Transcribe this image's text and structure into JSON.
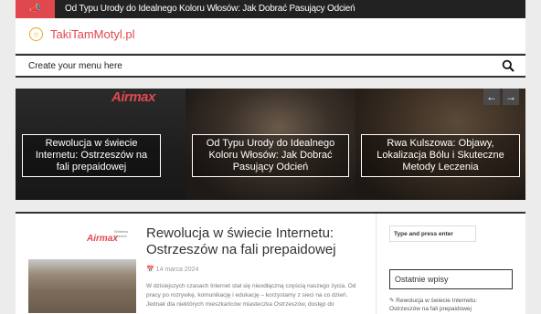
{
  "ticker": {
    "flag_icon": "megaphone-icon",
    "headline": "Od Typu Urody do Idealnego Koloru Włosów: Jak Dobrać Pasujący Odcień"
  },
  "header": {
    "logo_icon": "sun-icon",
    "site_title": "TakiTamMotyl.pl"
  },
  "menu": {
    "label": "Create your menu here",
    "search_icon": "search-icon"
  },
  "slider": {
    "slides": [
      {
        "caption": "Rewolucja w świecie Internetu: Ostrzeszów na fali prepaidowej",
        "brand": "Airmax"
      },
      {
        "caption": "Od Typu Urody do Idealnego Koloru Włosów: Jak Dobrać Pasujący Odcień"
      },
      {
        "caption": "Rwa Kulszowa: Objawy, Lokalizacja Bólu i Skuteczne Metody Leczenia"
      }
    ],
    "prev_label": "←",
    "next_label": "→"
  },
  "post": {
    "thumb_brand": "Airmax",
    "thumb_brand_tagline": "Wireless Internet",
    "title": "Rewolucja w świecie Internetu: Ostrzeszów na fali prepaidowej",
    "date": "14 marca 2024",
    "excerpt": "W dzisiejszych czasach Internet stał się nieodłączną częścią naszego życia. Od pracy po rozrywkę, komunikację i edukację – korzystamy z sieci na co dzień. Jednak dla niektórych mieszkańców miasteczka Ostrzeszów, dostęp do"
  },
  "sidebar": {
    "search_placeholder": "Type and press enter",
    "recent_title": "Ostatnie wpisy",
    "recent_items": [
      "Rewolucja w świecie Internetu:",
      "Ostrzeszów na fali prepaidowej"
    ]
  },
  "colors": {
    "accent": "#e0484e",
    "dark": "#222222",
    "background": "#ececec"
  }
}
